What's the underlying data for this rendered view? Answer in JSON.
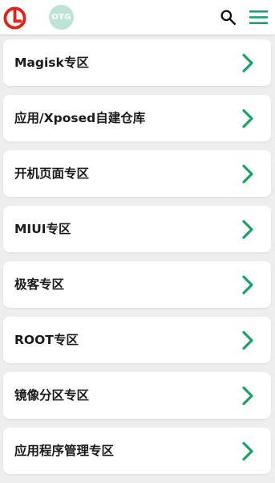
{
  "header": {
    "otg_badge": "OTG",
    "icons": {
      "logo": "logo-icon",
      "search": "search-icon",
      "menu": "menu-icon"
    },
    "colors": {
      "accent": "#1ea06a",
      "logo": "#e0241b",
      "otg_badge": "#bfe3d7"
    }
  },
  "items": [
    {
      "label": "Magisk专区"
    },
    {
      "label": "应用/Xposed自建仓库"
    },
    {
      "label": "开机页面专区"
    },
    {
      "label": "MIUI专区"
    },
    {
      "label": "极客专区"
    },
    {
      "label": "ROOT专区"
    },
    {
      "label": "镜像分区专区"
    },
    {
      "label": "应用程序管理专区"
    }
  ]
}
